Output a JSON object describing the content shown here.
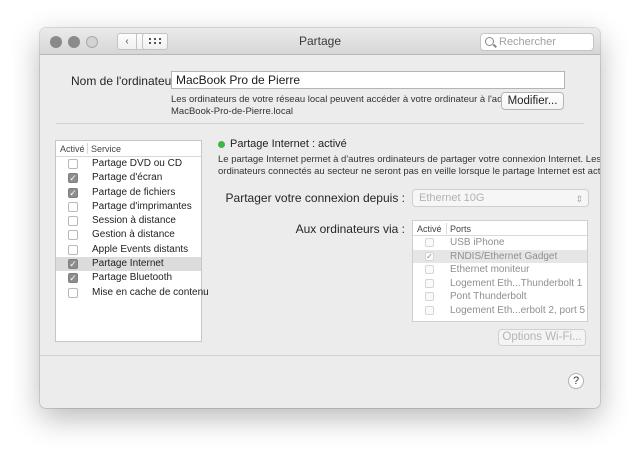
{
  "window": {
    "title": "Partage",
    "search_placeholder": "Rechercher",
    "nav_back": "‹",
    "nav_forward": "›"
  },
  "computer": {
    "name_label": "Nom de l'ordinateur :",
    "name_value": "MacBook Pro de Pierre",
    "info_line1": "Les ordinateurs de votre réseau local peuvent accéder à votre ordinateur à l'adresse :",
    "info_line2": "MacBook-Pro-de-Pierre.local",
    "modify_label": "Modifier..."
  },
  "services": {
    "col_active": "Activé",
    "col_service": "Service",
    "items": [
      {
        "name": "Partage DVD ou CD",
        "checked": false,
        "selected": false
      },
      {
        "name": "Partage d'écran",
        "checked": true,
        "selected": false
      },
      {
        "name": "Partage de fichiers",
        "checked": true,
        "selected": false
      },
      {
        "name": "Partage d'imprimantes",
        "checked": false,
        "selected": false
      },
      {
        "name": "Session à distance",
        "checked": false,
        "selected": false
      },
      {
        "name": "Gestion à distance",
        "checked": false,
        "selected": false
      },
      {
        "name": "Apple Events distants",
        "checked": false,
        "selected": false
      },
      {
        "name": "Partage Internet",
        "checked": true,
        "selected": true
      },
      {
        "name": "Partage Bluetooth",
        "checked": true,
        "selected": false
      },
      {
        "name": "Mise en cache de contenu",
        "checked": false,
        "selected": false
      }
    ]
  },
  "detail": {
    "status": "Partage Internet : activé",
    "status_color": "#3fb543",
    "desc_line1": "Le partage Internet permet à d'autres ordinateurs de partager votre connexion Internet. Les",
    "desc_line2": "ordinateurs connectés au secteur ne seront pas en veille lorsque le partage Internet est activé.",
    "share_from_label": "Partager votre connexion depuis :",
    "share_from_value": "Ethernet 10G",
    "via_label": "Aux ordinateurs via :",
    "ports_col_active": "Activé",
    "ports_col_ports": "Ports",
    "ports": [
      {
        "name": "USB iPhone",
        "checked": false,
        "selected": false
      },
      {
        "name": "RNDIS/Ethernet Gadget",
        "checked": true,
        "selected": true
      },
      {
        "name": "Ethernet moniteur",
        "checked": false,
        "selected": false
      },
      {
        "name": "Logement Eth...Thunderbolt 1",
        "checked": false,
        "selected": false
      },
      {
        "name": "Pont Thunderbolt",
        "checked": false,
        "selected": false
      },
      {
        "name": "Logement Eth...erbolt 2, port 5",
        "checked": false,
        "selected": false
      }
    ],
    "wifi_options_label": "Options Wi-Fi..."
  },
  "help_label": "?"
}
